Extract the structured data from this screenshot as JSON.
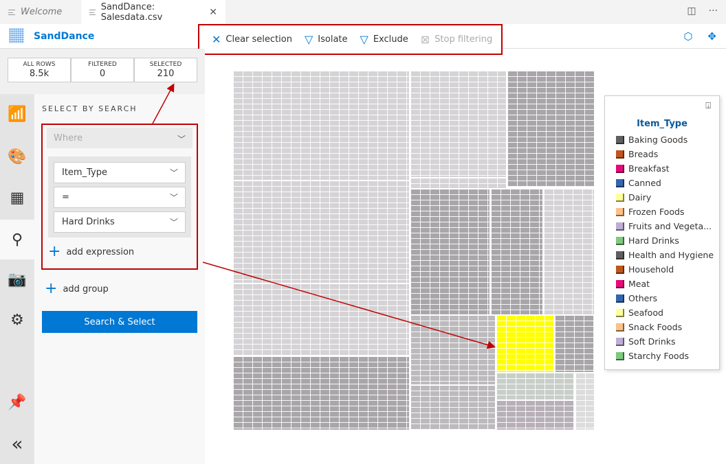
{
  "tabs": [
    {
      "label": "Welcome"
    },
    {
      "label": "SandDance: Salesdata.csv"
    }
  ],
  "app": {
    "title": "SandDance"
  },
  "toolbar": {
    "clear": "Clear selection",
    "isolate": "Isolate",
    "exclude": "Exclude",
    "stop": "Stop filtering"
  },
  "stats": [
    {
      "label": "ALL ROWS",
      "value": "8.5k"
    },
    {
      "label": "FILTERED",
      "value": "0"
    },
    {
      "label": "SELECTED",
      "value": "210"
    }
  ],
  "search": {
    "title": "SELECT BY SEARCH",
    "where": "Where",
    "field": "Item_Type",
    "operator": "=",
    "value": "Hard Drinks",
    "add_expression": "add expression",
    "add_group": "add group",
    "button": "Search & Select"
  },
  "legend": {
    "title": "Item_Type",
    "items": [
      {
        "label": "Baking Goods",
        "color": "#5f5f5f"
      },
      {
        "label": "Breads",
        "color": "#c0561b"
      },
      {
        "label": "Breakfast",
        "color": "#e8087a"
      },
      {
        "label": "Canned",
        "color": "#3366b0"
      },
      {
        "label": "Dairy",
        "color": "#ffff99"
      },
      {
        "label": "Frozen Foods",
        "color": "#fdc086"
      },
      {
        "label": "Fruits and Vegeta...",
        "color": "#beaed4"
      },
      {
        "label": "Hard Drinks",
        "color": "#7fc97f"
      },
      {
        "label": "Health and Hygiene",
        "color": "#5f5f5f"
      },
      {
        "label": "Household",
        "color": "#c0561b"
      },
      {
        "label": "Meat",
        "color": "#e8087a"
      },
      {
        "label": "Others",
        "color": "#3366b0"
      },
      {
        "label": "Seafood",
        "color": "#ffff99"
      },
      {
        "label": "Snack Foods",
        "color": "#fdc086"
      },
      {
        "label": "Soft Drinks",
        "color": "#beaed4"
      },
      {
        "label": "Starchy Foods",
        "color": "#7fc97f"
      }
    ]
  }
}
